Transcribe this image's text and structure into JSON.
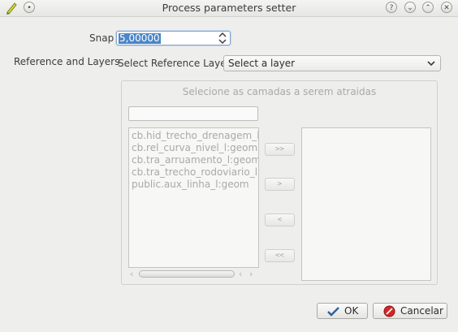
{
  "window": {
    "title": "Process parameters setter",
    "controls": [
      "help-icon",
      "minimize-icon",
      "maximize-icon",
      "close-icon"
    ]
  },
  "form": {
    "snap_label": "Snap",
    "snap_value": "5,00000",
    "reference_layers_label": "Reference and  Layers",
    "select_reference_label": "Select Reference Layer",
    "select_reference_value": "Select a layer"
  },
  "group": {
    "title": "Selecione as camadas a serem atraidas",
    "filter_value": "",
    "available_layers": [
      "cb.hid_trecho_drenagem_l:geom",
      "cb.rel_curva_nivel_l:geom",
      "cb.tra_arruamento_l:geom",
      "cb.tra_trecho_rodoviario_l:geom",
      "public.aux_linha_l:geom"
    ],
    "selected_layers": [],
    "move_buttons": [
      ">>",
      ">",
      "<",
      "<<"
    ]
  },
  "buttons": {
    "ok_label": "OK",
    "cancel_label": "Cancelar"
  }
}
